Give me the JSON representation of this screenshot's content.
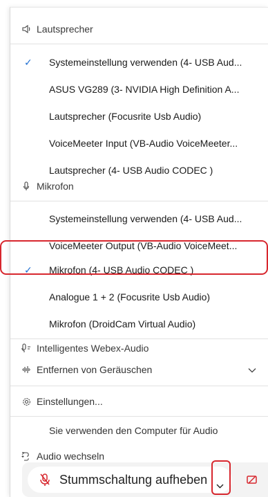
{
  "speaker_section": {
    "title": "Lautsprecher",
    "icon": "speaker-icon",
    "items": [
      {
        "label": "Systemeinstellung verwenden (4- USB Aud...",
        "selected": true
      },
      {
        "label": "ASUS VG289 (3- NVIDIA High Definition A...",
        "selected": false
      },
      {
        "label": "Lautsprecher (Focusrite Usb Audio)",
        "selected": false
      },
      {
        "label": "VoiceMeeter Input (VB-Audio VoiceMeeter...",
        "selected": false
      },
      {
        "label": "Lautsprecher (4- USB Audio CODEC )",
        "selected": false
      }
    ]
  },
  "mic_section": {
    "title": "Mikrofon",
    "icon": "microphone-icon",
    "items": [
      {
        "label": "Systemeinstellung verwenden (4- USB Aud...",
        "selected": false
      },
      {
        "label": "VoiceMeeter Output (VB-Audio VoiceMeet...",
        "selected": false
      },
      {
        "label": "Mikrofon (4- USB Audio CODEC )",
        "selected": true
      },
      {
        "label": "Analogue 1 + 2 (Focusrite Usb Audio)",
        "selected": false
      },
      {
        "label": "Mikrofon (DroidCam Virtual Audio)",
        "selected": false
      }
    ]
  },
  "intelligent_audio": {
    "label": "Intelligentes Webex-Audio",
    "icon": "intelligent-audio-icon"
  },
  "noise_removal": {
    "label": "Entfernen von Geräuschen",
    "icon": "noise-wave-icon"
  },
  "settings": {
    "label": "Einstellungen...",
    "icon": "gear-icon"
  },
  "computer_audio_note": "Sie verwenden den Computer für Audio",
  "switch_audio": {
    "label": "Audio wechseln",
    "icon": "switch-audio-icon"
  },
  "bottom_bar": {
    "unmute_label": "Stummschaltung aufheben",
    "mute_icon": "muted-microphone-icon",
    "video_icon": "video-off-icon"
  },
  "colors": {
    "check": "#1f6fd1",
    "highlight": "#d7262d",
    "muted": "#d7262d"
  }
}
